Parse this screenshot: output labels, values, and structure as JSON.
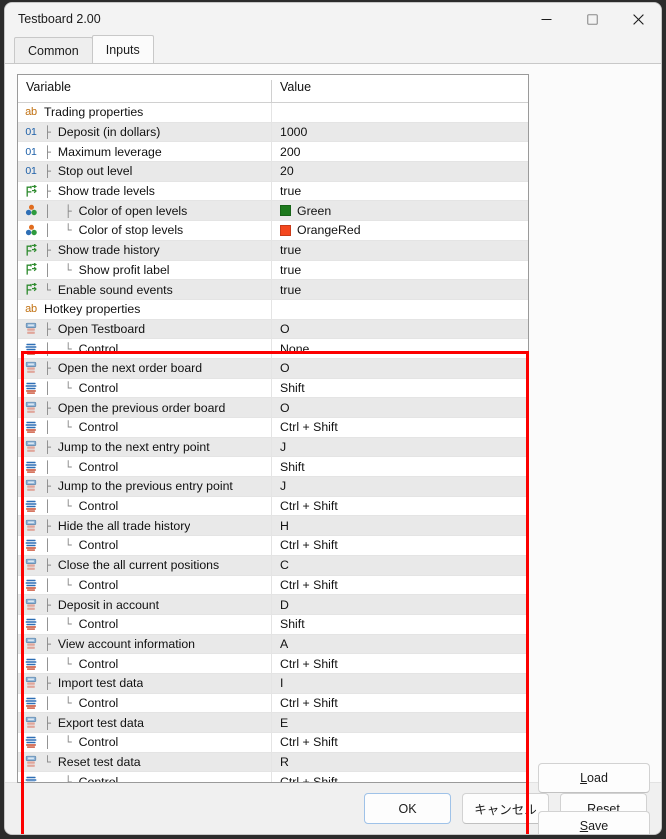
{
  "window": {
    "title": "Testboard 2.00",
    "caption": {
      "minimize": "minimize-button",
      "maximize": "maximize-button",
      "close": "close-button"
    }
  },
  "tabs": [
    {
      "label": "Common",
      "active": false
    },
    {
      "label": "Inputs",
      "active": true
    }
  ],
  "grid": {
    "headers": {
      "variable": "Variable",
      "value": "Value"
    },
    "rows": [
      {
        "icon": "ab",
        "tree": "",
        "name": "Trading properties",
        "value": "",
        "group": true
      },
      {
        "icon": "01",
        "tree": "├ ",
        "name": "Deposit (in dollars)",
        "value": "1000"
      },
      {
        "icon": "01",
        "tree": "├ ",
        "name": "Maximum leverage",
        "value": "200"
      },
      {
        "icon": "01",
        "tree": "├ ",
        "name": "Stop out level",
        "value": "20"
      },
      {
        "icon": "bool",
        "tree": "├ ",
        "name": "Show trade levels",
        "value": "true"
      },
      {
        "icon": "color",
        "tree": "│  ├ ",
        "name": "Color of open levels",
        "value": "Green",
        "swatch": "#1e7a1e"
      },
      {
        "icon": "color",
        "tree": "│  └ ",
        "name": "Color of stop levels",
        "value": "OrangeRed",
        "swatch": "#f4471e"
      },
      {
        "icon": "bool",
        "tree": "├ ",
        "name": "Show trade history",
        "value": "true"
      },
      {
        "icon": "bool",
        "tree": "│  └ ",
        "name": "Show profit label",
        "value": "true"
      },
      {
        "icon": "bool",
        "tree": "└ ",
        "name": "Enable sound events",
        "value": "true"
      },
      {
        "icon": "ab",
        "tree": "",
        "name": "Hotkey properties",
        "value": "",
        "group": true
      },
      {
        "icon": "key",
        "tree": "├ ",
        "name": "Open Testboard",
        "value": "O"
      },
      {
        "icon": "mod",
        "tree": "│  └ ",
        "name": "Control",
        "value": "None"
      },
      {
        "icon": "key",
        "tree": "├ ",
        "name": "Open the next order board",
        "value": "O"
      },
      {
        "icon": "mod",
        "tree": "│  └ ",
        "name": "Control",
        "value": "Shift"
      },
      {
        "icon": "key",
        "tree": "├ ",
        "name": "Open the previous order board",
        "value": "O"
      },
      {
        "icon": "mod",
        "tree": "│  └ ",
        "name": "Control",
        "value": "Ctrl + Shift"
      },
      {
        "icon": "key",
        "tree": "├ ",
        "name": "Jump to the next entry point",
        "value": "J"
      },
      {
        "icon": "mod",
        "tree": "│  └ ",
        "name": "Control",
        "value": "Shift"
      },
      {
        "icon": "key",
        "tree": "├ ",
        "name": "Jump to the previous entry point",
        "value": "J"
      },
      {
        "icon": "mod",
        "tree": "│  └ ",
        "name": "Control",
        "value": "Ctrl + Shift"
      },
      {
        "icon": "key",
        "tree": "├ ",
        "name": "Hide the all trade history",
        "value": "H"
      },
      {
        "icon": "mod",
        "tree": "│  └ ",
        "name": "Control",
        "value": "Ctrl + Shift"
      },
      {
        "icon": "key",
        "tree": "├ ",
        "name": "Close the all current positions",
        "value": "C"
      },
      {
        "icon": "mod",
        "tree": "│  └ ",
        "name": "Control",
        "value": "Ctrl + Shift"
      },
      {
        "icon": "key",
        "tree": "├ ",
        "name": "Deposit in account",
        "value": "D"
      },
      {
        "icon": "mod",
        "tree": "│  └ ",
        "name": "Control",
        "value": "Shift"
      },
      {
        "icon": "key",
        "tree": "├ ",
        "name": "View account information",
        "value": "A"
      },
      {
        "icon": "mod",
        "tree": "│  └ ",
        "name": "Control",
        "value": "Ctrl + Shift"
      },
      {
        "icon": "key",
        "tree": "├ ",
        "name": "Import test data",
        "value": "I"
      },
      {
        "icon": "mod",
        "tree": "│  └ ",
        "name": "Control",
        "value": "Ctrl + Shift"
      },
      {
        "icon": "key",
        "tree": "├ ",
        "name": "Export test data",
        "value": "E"
      },
      {
        "icon": "mod",
        "tree": "│  └ ",
        "name": "Control",
        "value": "Ctrl + Shift"
      },
      {
        "icon": "key",
        "tree": "└ ",
        "name": "Reset test data",
        "value": "R"
      },
      {
        "icon": "mod",
        "tree": "   └ ",
        "name": "Control",
        "value": "Ctrl + Shift"
      }
    ]
  },
  "side_buttons": [
    {
      "label": "Load",
      "mnemonic": "L"
    },
    {
      "label": "Save",
      "mnemonic": "S"
    }
  ],
  "footer_buttons": [
    {
      "label": "OK",
      "default": true
    },
    {
      "label": "キャンセル",
      "default": false
    },
    {
      "label": "Reset",
      "default": false
    }
  ],
  "annotation": {
    "highlight_color": "#fc0000",
    "target": "Hotkey properties"
  }
}
